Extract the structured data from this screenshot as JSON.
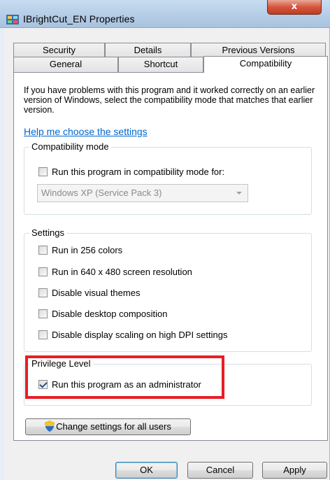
{
  "window": {
    "title": "IBrightCut_EN Properties",
    "close_label": "x"
  },
  "tabs": {
    "row1": [
      "Security",
      "Details",
      "Previous Versions"
    ],
    "row2": [
      "General",
      "Shortcut",
      "Compatibility"
    ],
    "active": "Compatibility"
  },
  "intro": {
    "text": "If you have problems with this program and it worked correctly on an earlier version of Windows, select the compatibility mode that matches that earlier version.",
    "help_link": "Help me choose the settings"
  },
  "compat_mode": {
    "label": "Compatibility mode",
    "checkbox": {
      "label": "Run this program in compatibility mode for:",
      "checked": false
    },
    "dropdown_value": "Windows XP (Service Pack 3)"
  },
  "settings": {
    "label": "Settings",
    "options": [
      {
        "label": "Run in 256 colors",
        "checked": false
      },
      {
        "label": "Run in 640 x 480 screen resolution",
        "checked": false
      },
      {
        "label": "Disable visual themes",
        "checked": false
      },
      {
        "label": "Disable desktop composition",
        "checked": false
      },
      {
        "label": "Disable display scaling on high DPI settings",
        "checked": false
      }
    ]
  },
  "privilege": {
    "label": "Privilege Level",
    "checkbox": {
      "label": "Run this program as an administrator",
      "checked": true
    }
  },
  "buttons": {
    "change_all": "Change settings for all users",
    "ok": "OK",
    "cancel": "Cancel",
    "apply": "Apply"
  },
  "icons": {
    "app": "app-icon",
    "shield": "uac-shield-icon"
  },
  "colors": {
    "highlight_border": "#e81e25",
    "link": "#0066cc"
  }
}
